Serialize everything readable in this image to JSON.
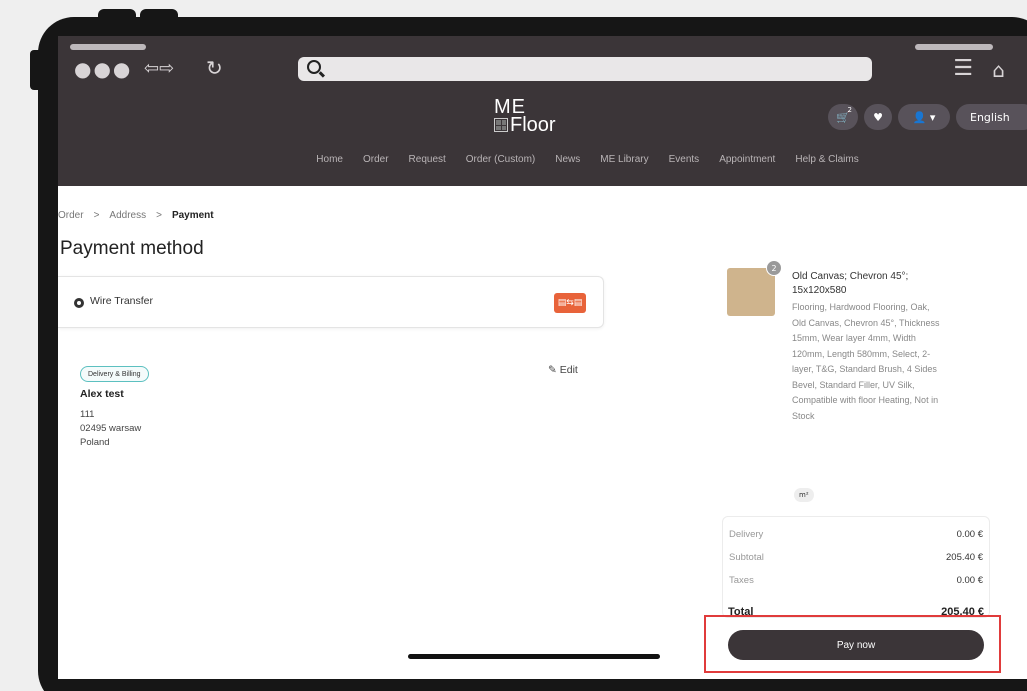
{
  "browser": {
    "address_value": ""
  },
  "header": {
    "logo_line1": "ME",
    "logo_line2": "Floor",
    "cart_count": "2",
    "language": "English"
  },
  "nav": [
    "Home",
    "Order",
    "Request",
    "Order (Custom)",
    "News",
    "ME Library",
    "Events",
    "Appointment",
    "Help & Claims"
  ],
  "breadcrumb": {
    "items": [
      "Order",
      "Address",
      "Payment"
    ],
    "separator": ">"
  },
  "page_title": "Payment method",
  "payment": {
    "method_label": "Wire Transfer",
    "method_icon_text": "▤⇆▤"
  },
  "address": {
    "badge": "Delivery & Billing",
    "edit_label": "Edit",
    "name": "Alex test",
    "line1": "111",
    "line2": "02495 warsaw",
    "line3": "Poland"
  },
  "product": {
    "quantity": "2",
    "name": "Old Canvas; Chevron 45°; 15x120x580",
    "description": "Flooring, Hardwood Flooring, Oak, Old Canvas, Chevron 45°, Thickness 15mm, Wear layer 4mm, Width 120mm, Length 580mm, Select, 2-layer, T&G, Standard Brush, 4 Sides Bevel, Standard Filler, UV Silk, Compatible with floor Heating, Not in Stock",
    "unit": "m²"
  },
  "totals": {
    "delivery_label": "Delivery",
    "delivery_value": "0.00 €",
    "subtotal_label": "Subtotal",
    "subtotal_value": "205.40 €",
    "taxes_label": "Taxes",
    "taxes_value": "0.00 €",
    "total_label": "Total",
    "total_value": "205.40 €"
  },
  "pay_button": "Pay now",
  "colors": {
    "header_bg": "#3b3538",
    "payment_icon": "#e8633a",
    "highlight": "#e03b3b"
  }
}
